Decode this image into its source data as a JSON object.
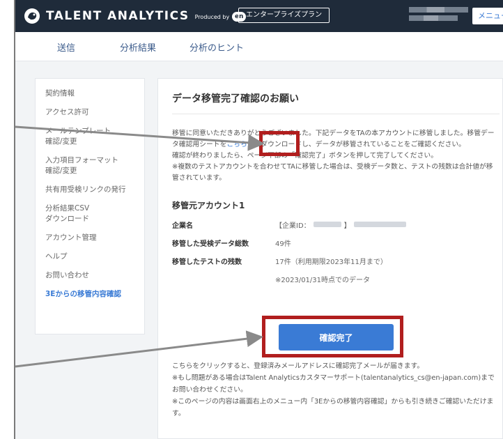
{
  "header": {
    "brand": "TALENT ANALYTICS",
    "produced_by": "Produced by",
    "en_logo": "en",
    "plan": "エンタープライズプラン",
    "menu": "メニュー"
  },
  "tabs": [
    "送信",
    "分析結果",
    "分析のヒント"
  ],
  "sidebar": {
    "items": [
      {
        "label": "契約情報"
      },
      {
        "label": "アクセス許可"
      },
      {
        "label": "メールテンプレート\n確認/変更"
      },
      {
        "label": "入力項目フォーマット\n確認/変更"
      },
      {
        "label": "共有用受検リンクの発行"
      },
      {
        "label": "分析結果CSV\nダウンロード"
      },
      {
        "label": "アカウント管理"
      },
      {
        "label": "ヘルプ"
      },
      {
        "label": "お問い合わせ"
      },
      {
        "label": "3Eからの移管内容確認",
        "active": true
      }
    ]
  },
  "main": {
    "title": "データ移管完了確認のお願い",
    "para1_a": "移管に同意いただきありがとうございました。下記データをTAの本アカウントに移管しました。移管データ確認用シートを",
    "para1_link": "こちら",
    "para1_b": "からダウンロードし、データが移管されていることをご確認ください。",
    "para2": "確認が終わりましたら、ページ下部の「確認完了」ボタンを押して完了してください。",
    "para3": "※複数のテストアカウントを合わせてTAに移管した場合は、受検データ数と、テストの残数は合計値が移管されています。",
    "account_title": "移管元アカウント1",
    "rows": {
      "company_key": "企業名",
      "company_prefix": "【企業ID：",
      "company_mid": "】",
      "examinees_key": "移管した受検データ総数",
      "examinees_val": "49件",
      "tests_key": "移管したテストの残数",
      "tests_val": "17件（利用期限2023年11月まで）",
      "asof_val": "※2023/01/31時点でのデータ"
    },
    "confirm_button": "確認完了",
    "note1": "こちらをクリックすると、登録済みメールアドレスに確認完了メールが届きます。",
    "note2": "※もし問題がある場合はTalent Analyticsカスタマーサポート(talentanalytics_cs@en-japan.com)までお問い合わせください。",
    "note3": "※このページの内容は画面右上のメニュー内「3Eからの移管内容確認」からも引き続きご確認いただけます。"
  },
  "colors": {
    "header_bg": "#1f2b3a",
    "accent": "#3a7bd5",
    "annotation_red": "#b11e1e"
  }
}
